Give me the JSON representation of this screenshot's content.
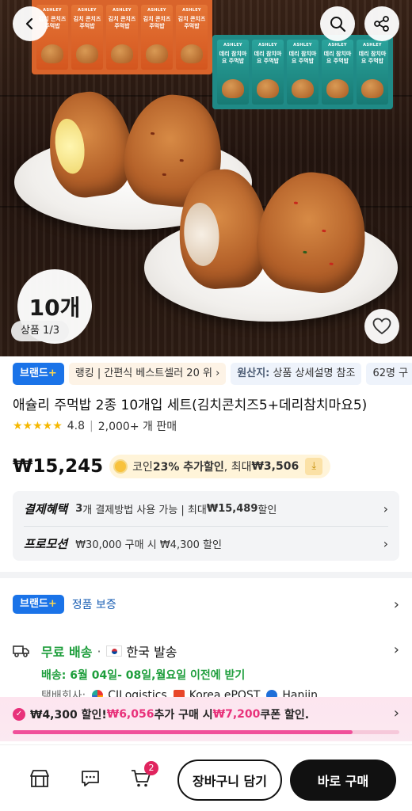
{
  "hero": {
    "orange_pack_brand": "ASHLEY",
    "orange_pack_name": "김치 콘치즈 주먹밥",
    "teal_pack_brand": "ASHLEY",
    "teal_pack_name": "데리 참치마요 주먹밥",
    "count_badge": "10개",
    "page_indicator": "상품 1/3",
    "back_icon": "chevron-left-icon",
    "search_icon": "search-icon",
    "share_icon": "share-icon",
    "wishlist_icon": "heart-icon"
  },
  "chips": [
    {
      "label": "브랜드",
      "plus": "+"
    },
    {
      "label": "랭킹 | 간편식 베스트셀러 20 위 ›"
    },
    {
      "key": "원산지:",
      "value": " 상품 상세설명 참조"
    },
    {
      "label": "62명 구"
    }
  ],
  "product": {
    "title": "애슐리 주먹밥 2종 10개입 세트(김치콘치즈5+데리참치마요5)",
    "stars": "★★★★★",
    "rating": "4.8",
    "sold": "2,000+ 개 판매",
    "price": "₩15,245",
    "coupon_prefix": "코인 ",
    "coupon_percent": "23% 추가할인",
    "coupon_mid": ", 최대 ",
    "coupon_max": "₩3,506"
  },
  "benefits": [
    {
      "label": "결제혜택",
      "count": "3",
      "text": "개 결제방법 사용 가능 | 최대 ",
      "amount": "₩15,489",
      "suffix": " 할인"
    },
    {
      "label": "프로모션",
      "text": "₩30,000 구매 시 ₩4,300 할인"
    }
  ],
  "brand_assurance": {
    "badge": "브랜드",
    "plus": "+",
    "text": "정품 보증"
  },
  "shipping": {
    "free": "무료 배송",
    "dot": "·",
    "origin": "한국 발송",
    "schedule": "배송: 6월 04일- 08일,월요일 이전에 받기",
    "carrier_label": "택배회사:",
    "carriers": [
      "CJLogistics",
      "Korea ePOST",
      "Hanjin"
    ]
  },
  "promo": {
    "discount": "₩4,300 할인!",
    "extra": "₩6,056",
    "mid": "추가 구매 시",
    "coupon": "₩7,200",
    "tail": "쿠폰 할인.",
    "progress_fraction": 0.88
  },
  "bottom_bar": {
    "store_icon": "store-icon",
    "chat_icon": "chat-icon",
    "cart_icon": "cart-icon",
    "cart_count": "2",
    "add_to_cart": "장바구니 담기",
    "buy_now": "바로 구매"
  },
  "colors": {
    "brand_blue": "#1a73e8",
    "free_green": "#1e9e3c",
    "promo_pink": "#e8317a"
  }
}
